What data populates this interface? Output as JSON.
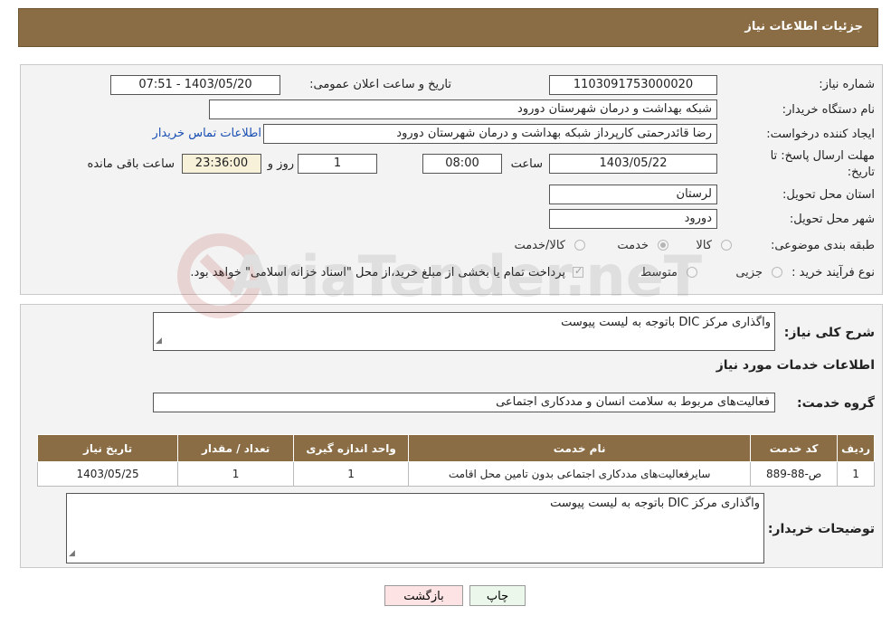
{
  "header": {
    "title": "جزئیات اطلاعات نیاز"
  },
  "form": {
    "need_number_label": "شماره نیاز:",
    "need_number": "1103091753000020",
    "announce_label": "تاریخ و ساعت اعلان عمومی:",
    "announce_value": "1403/05/20 - 07:51",
    "buyer_org_label": "نام دستگاه خریدار:",
    "buyer_org": "شبکه بهداشت و درمان شهرستان دورود",
    "requester_label": "ایجاد کننده درخواست:",
    "requester": "رضا قائدرحمتی کارپرداز شبکه بهداشت و درمان شهرستان دورود",
    "contact_link": "اطلاعات تماس خریدار",
    "deadline_label_1": "مهلت ارسال پاسخ: تا",
    "deadline_label_2": "تاریخ:",
    "deadline_date": "1403/05/22",
    "time_label": "ساعت",
    "deadline_time": "08:00",
    "days_value": "1",
    "days_label": "روز و",
    "remaining_time": "23:36:00",
    "remaining_label": "ساعت باقی مانده",
    "province_label": "استان محل تحویل:",
    "province": "لرستان",
    "city_label": "شهر محل تحویل:",
    "city": "دورود",
    "category_label": "طبقه بندی موضوعی:",
    "category_options": [
      "کالا",
      "خدمت",
      "کالا/خدمت"
    ],
    "category_selected": "خدمت",
    "process_label": "نوع فرآیند خرید :",
    "process_options": [
      "جزیی",
      "متوسط"
    ],
    "payment_note": "پرداخت تمام یا بخشی از مبلغ خرید،از محل \"اسناد خزانه اسلامی\" خواهد بود."
  },
  "details": {
    "summary_label": "شرح کلی نیاز:",
    "summary": "واگذاری مرکز DIC باتوجه به لیست پیوست",
    "services_title": "اطلاعات خدمات مورد نیاز",
    "service_group_label": "گروه خدمت:",
    "service_group": "فعالیت‌های مربوط به سلامت انسان و مددکاری اجتماعی",
    "table": {
      "headers": [
        "ردیف",
        "کد خدمت",
        "نام خدمت",
        "واحد اندازه گیری",
        "تعداد / مقدار",
        "تاریخ نیاز"
      ],
      "rows": [
        [
          "1",
          "ص-88-889",
          "سایرفعالیت‌های مددکاری اجتماعی بدون تامین محل اقامت",
          "1",
          "1",
          "1403/05/25"
        ]
      ]
    },
    "buyer_notes_label": "توضیحات خریدار:",
    "buyer_notes": "واگذاری مرکز DIC باتوجه به لیست پیوست"
  },
  "buttons": {
    "print": "چاپ",
    "back": "بازگشت"
  },
  "watermark": {
    "text": "AriaTender.neT"
  },
  "colors": {
    "header": "#8a6d44",
    "link": "#1a4fb3",
    "back_button": "#fde3e3",
    "print_button": "#eaf7ea"
  }
}
